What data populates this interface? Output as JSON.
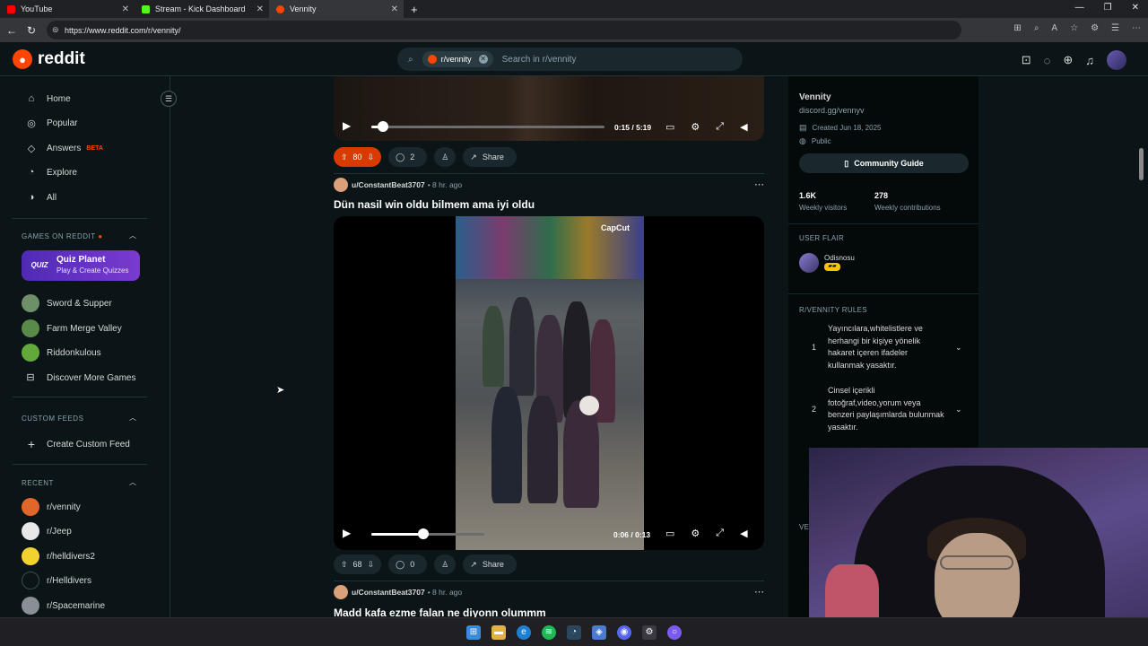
{
  "browser": {
    "tabs": [
      {
        "title": "YouTube",
        "color": "#ff0000"
      },
      {
        "title": "Stream - Kick Dashboard",
        "color": "#53fc18"
      },
      {
        "title": "Vennity",
        "color": "#ff4500"
      }
    ],
    "url": "https://www.reddit.com/r/vennity/"
  },
  "header": {
    "logo_text": "reddit",
    "search_chip": "r/vennity",
    "search_placeholder": "Search in r/vennity"
  },
  "sidebar": {
    "nav": [
      {
        "label": "Home",
        "icon": "home-icon"
      },
      {
        "label": "Popular",
        "icon": "popular-icon"
      },
      {
        "label": "Answers",
        "icon": "answers-icon",
        "badge": "BETA"
      },
      {
        "label": "Explore",
        "icon": "explore-icon"
      },
      {
        "label": "All",
        "icon": "all-icon"
      }
    ],
    "games_heading": "GAMES ON REDDIT",
    "quiz_title": "Quiz Planet",
    "quiz_sub": "Play & Create Quizzes",
    "quiz_logo": "QUIZ",
    "games": [
      {
        "label": "Sword & Supper",
        "color": "#6f8f6a"
      },
      {
        "label": "Farm Merge Valley",
        "color": "#5a8a4a"
      },
      {
        "label": "Riddonkulous",
        "color": "#62a83a"
      },
      {
        "label": "Discover More Games",
        "color": "#0b1416"
      }
    ],
    "custom_heading": "CUSTOM FEEDS",
    "create_feed": "Create Custom Feed",
    "recent_heading": "RECENT",
    "recent": [
      {
        "label": "r/vennity",
        "color": "#e0662a"
      },
      {
        "label": "r/Jeep",
        "color": "#e8e8e8"
      },
      {
        "label": "r/helldivers2",
        "color": "#f2d22e"
      },
      {
        "label": "r/Helldivers",
        "color": "#0b1416"
      },
      {
        "label": "r/Spacemarine",
        "color": "#8a8f96"
      }
    ]
  },
  "feed": {
    "video1": {
      "time": "0:15 / 5:19",
      "progress": 0.05
    },
    "post1_actions": {
      "votes": "80",
      "comments": "2",
      "share": "Share"
    },
    "post2": {
      "author": "u/ConstantBeat3707",
      "time": "• 8 hr. ago",
      "title": "Dün nasil win oldu bilmem ama iyi oldu",
      "watermark": "CapCut",
      "video_time": "0:06 / 0:13",
      "progress": 0.46,
      "votes": "68",
      "comments": "0",
      "share": "Share"
    },
    "post3": {
      "author": "u/ConstantBeat3707",
      "time": "• 8 hr. ago",
      "title": "Madd kafa ezme falan ne diyonn olummm"
    }
  },
  "community": {
    "name": "Vennity",
    "link": "discord.gg/vennyv",
    "created": "Created Jun 18, 2025",
    "visibility": "Public",
    "guide": "Community Guide",
    "visitors": "1.6K",
    "visitors_label": "Weekly visitors",
    "contributions": "278",
    "contributions_label": "Weekly contributions",
    "flair_heading": "USER FLAIR",
    "flair_user": "Odisnosu",
    "rules_heading": "R/VENNITY RULES",
    "rules": [
      {
        "num": "1",
        "text": "Yayıncılara,whitelistlere ve herhangi bir kişiye yönelik hakaret içeren ifadeler kullanmak yasaktır."
      },
      {
        "num": "2",
        "text": "Cinsel içerikli fotoğraf,video,yorum veya benzeri paylaşımlarda bulunmak yasaktır."
      }
    ],
    "more_heading": "VE"
  }
}
